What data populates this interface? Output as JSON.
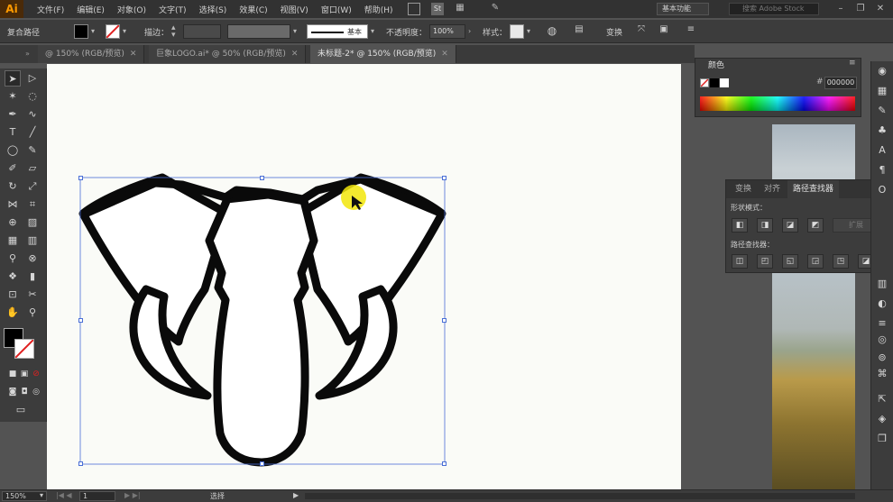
{
  "app": {
    "logo": "Ai",
    "menus": [
      "文件(F)",
      "编辑(E)",
      "对象(O)",
      "文字(T)",
      "选择(S)",
      "效果(C)",
      "视图(V)",
      "窗口(W)",
      "帮助(H)"
    ],
    "workspace": "基本功能",
    "search_placeholder": "搜索 Adobe Stock",
    "window_controls": [
      "–",
      "❐",
      "✕"
    ]
  },
  "control_bar": {
    "selection_label": "复合路径",
    "stroke_label": "描边：",
    "stroke_style": "基本",
    "opacity_label": "不透明度：",
    "opacity_value": "100%",
    "style_label": "样式：",
    "transform_label": "变换"
  },
  "tabs": [
    {
      "label": "@ 150% (RGB/预览)",
      "active": false
    },
    {
      "label": "巨象LOGO.ai* @ 50% (RGB/预览)",
      "active": false
    },
    {
      "label": "未标题-2* @ 150% (RGB/预览)",
      "active": true
    }
  ],
  "color_panel": {
    "title": "颜色",
    "hex_prefix": "#",
    "hex_value": "000000"
  },
  "pathfinder": {
    "tabs": [
      "变换",
      "对齐",
      "路径查找器"
    ],
    "shape_modes_label": "形状模式：",
    "expand_label": "扩展",
    "pathfinders_label": "路径查找器："
  },
  "status_bar": {
    "zoom": "150%",
    "artboard_num": "1",
    "tool_status": "选择"
  },
  "colors": {
    "fill": "#000000",
    "accent_cursor": "#f2e60a",
    "selection": "#4a6fd6"
  }
}
